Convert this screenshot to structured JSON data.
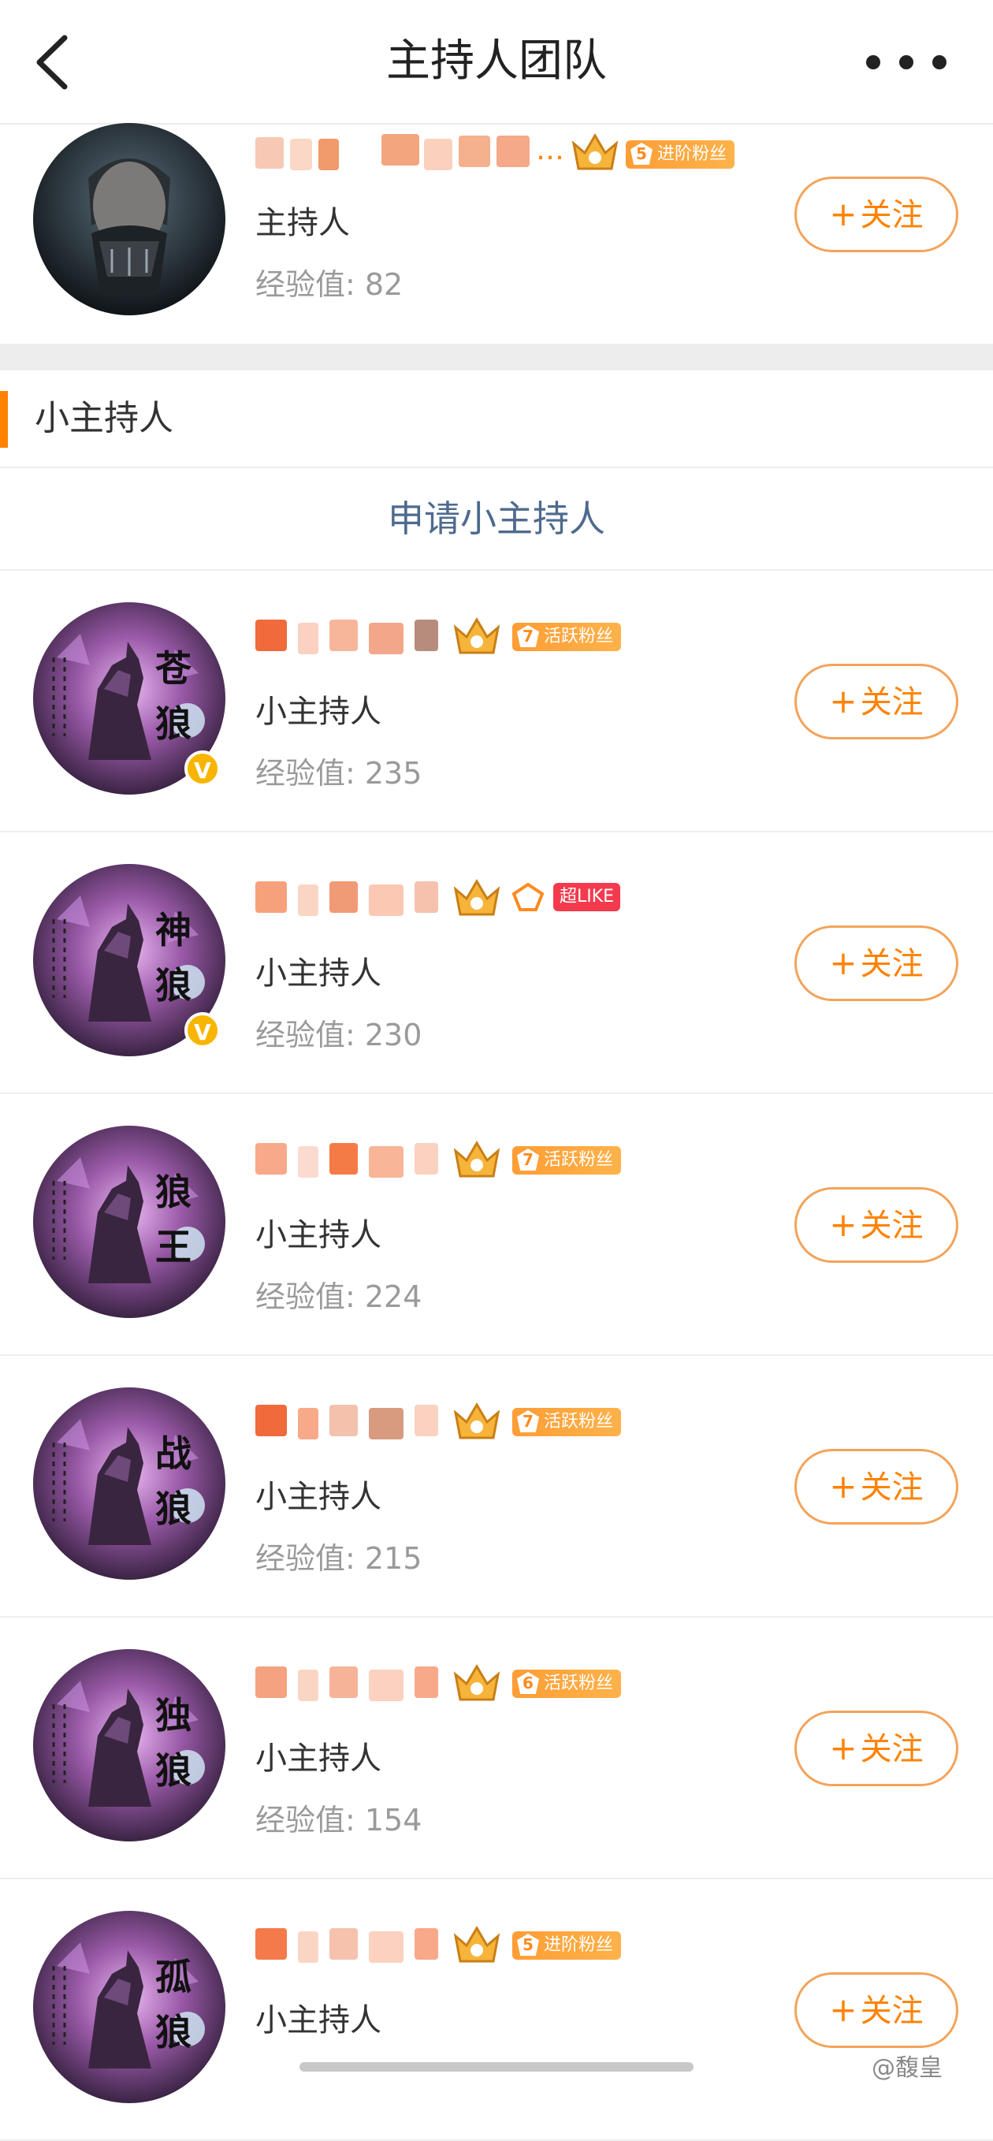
{
  "navbar": {
    "title": "主持人团队",
    "back_icon": "chevron-left-icon",
    "more_icon": "more-dots-icon"
  },
  "host": {
    "name_suffix": "…",
    "role": "主持人",
    "exp_label": "经验值: 82",
    "badge_level": "5",
    "badge_text": "进阶粉丝",
    "follow_label": "关注"
  },
  "section": {
    "title": "小主持人",
    "apply_label": "申请小主持人"
  },
  "members": [
    {
      "avatar_text": "苍狼",
      "role": "小主持人",
      "exp_label": "经验值: 235",
      "badge_level": "7",
      "badge_text": "活跃粉丝",
      "follow_label": "关注",
      "verified": true
    },
    {
      "avatar_text": "神狼",
      "role": "小主持人",
      "exp_label": "经验值: 230",
      "like_badge": "超LIKE",
      "follow_label": "关注",
      "verified": true
    },
    {
      "avatar_text": "狼王",
      "role": "小主持人",
      "exp_label": "经验值: 224",
      "badge_level": "7",
      "badge_text": "活跃粉丝",
      "follow_label": "关注",
      "verified": false
    },
    {
      "avatar_text": "战狼",
      "role": "小主持人",
      "exp_label": "经验值: 215",
      "badge_level": "7",
      "badge_text": "活跃粉丝",
      "follow_label": "关注",
      "verified": false
    },
    {
      "avatar_text": "独狼",
      "role": "小主持人",
      "exp_label": "经验值: 154",
      "badge_level": "6",
      "badge_text": "活跃粉丝",
      "follow_label": "关注",
      "verified": false
    },
    {
      "avatar_text": "孤狼",
      "role": "小主持人",
      "badge_level": "5",
      "badge_text": "进阶粉丝",
      "follow_label": "关注",
      "verified": false
    }
  ],
  "watermark": "@馥皇",
  "colors": {
    "accent": "#ff8200",
    "link": "#4e6a8e",
    "badge": "#ffa03c",
    "like": "#f43a4d",
    "verified": "#f7b500"
  }
}
